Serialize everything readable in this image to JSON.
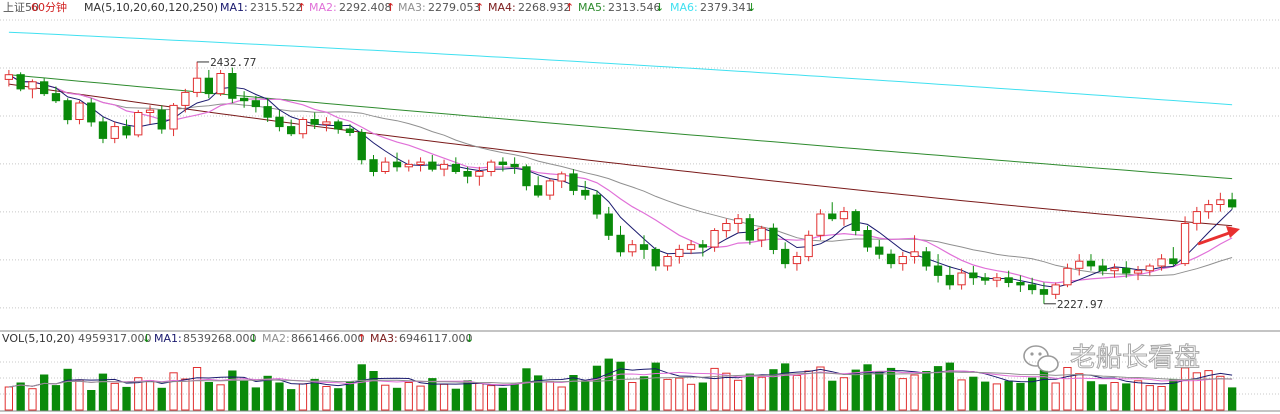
{
  "header": {
    "symbol": "上证50",
    "period": "60分钟",
    "ma_label": "MA(5,10,20,60,120,250)",
    "ma1_label": "MA1:",
    "ma1_value": "2315.522",
    "ma1_arrow": "↑",
    "ma2_label": "MA2:",
    "ma2_value": "2292.408",
    "ma2_arrow": "↑",
    "ma3_label": "MA3:",
    "ma3_value": "2279.053",
    "ma3_arrow": "↑",
    "ma4_label": "MA4:",
    "ma4_value": "2268.932",
    "ma4_arrow": "↑",
    "ma5_label": "MA5:",
    "ma5_value": "2313.546",
    "ma5_arrow": "↓",
    "ma6_label": "MA6:",
    "ma6_value": "2379.341",
    "ma6_arrow": "↓"
  },
  "volume_header": {
    "vol_label": "VOL(5,10,20)",
    "vol_value": "4959317.000",
    "vol_arrow": "↓",
    "ma1_label": "MA1:",
    "ma1_value": "8539268.000",
    "ma1_arrow": "↓",
    "ma2_label": "MA2:",
    "ma2_value": "8661466.000",
    "ma2_arrow": "↑",
    "ma3_label": "MA3:",
    "ma3_value": "6946117.000",
    "ma3_arrow": "↓"
  },
  "annotations": {
    "high_label": "2432.77",
    "low_label": "2227.97"
  },
  "watermark": {
    "text": "老船长看盘"
  },
  "colors": {
    "up": "#e03030",
    "down": "#0a8a0a",
    "ma1": "#1a1a6e",
    "ma2": "#e070d8",
    "ma3": "#909090",
    "ma4": "#7a1a1a",
    "ma5": "#2e8b2e",
    "ma6": "#40e0f0",
    "arrow": "#e83030",
    "label_gray": "#555555",
    "label_red": "#d02020",
    "label_green": "#108a10"
  },
  "chart_data": [
    {
      "type": "candlestick",
      "title": "上证50 60分钟",
      "ylim": [
        2210,
        2470
      ],
      "ohlc": [
        [
          2418,
          2426,
          2412,
          2422
        ],
        [
          2422,
          2424,
          2408,
          2410
        ],
        [
          2410,
          2418,
          2402,
          2416
        ],
        [
          2416,
          2419,
          2404,
          2406
        ],
        [
          2406,
          2412,
          2398,
          2400
        ],
        [
          2400,
          2402,
          2380,
          2384
        ],
        [
          2384,
          2400,
          2380,
          2398
        ],
        [
          2398,
          2402,
          2378,
          2382
        ],
        [
          2382,
          2386,
          2364,
          2368
        ],
        [
          2368,
          2382,
          2364,
          2378
        ],
        [
          2378,
          2384,
          2368,
          2371
        ],
        [
          2371,
          2392,
          2369,
          2390
        ],
        [
          2390,
          2396,
          2380,
          2392
        ],
        [
          2392,
          2396,
          2372,
          2376
        ],
        [
          2376,
          2398,
          2370,
          2396
        ],
        [
          2396,
          2410,
          2390,
          2407
        ],
        [
          2407,
          2433,
          2403,
          2419
        ],
        [
          2419,
          2426,
          2402,
          2406
        ],
        [
          2406,
          2426,
          2404,
          2423
        ],
        [
          2423,
          2428,
          2398,
          2402
        ],
        [
          2402,
          2408,
          2394,
          2400
        ],
        [
          2400,
          2404,
          2390,
          2395
        ],
        [
          2395,
          2402,
          2382,
          2386
        ],
        [
          2386,
          2392,
          2374,
          2378
        ],
        [
          2378,
          2384,
          2370,
          2372
        ],
        [
          2372,
          2386,
          2368,
          2384
        ],
        [
          2384,
          2390,
          2376,
          2380
        ],
        [
          2380,
          2386,
          2374,
          2382
        ],
        [
          2382,
          2384,
          2372,
          2376
        ],
        [
          2376,
          2380,
          2370,
          2373
        ],
        [
          2373,
          2376,
          2346,
          2350
        ],
        [
          2350,
          2354,
          2336,
          2340
        ],
        [
          2340,
          2352,
          2338,
          2348
        ],
        [
          2348,
          2356,
          2340,
          2344
        ],
        [
          2344,
          2350,
          2340,
          2346
        ],
        [
          2346,
          2352,
          2340,
          2348
        ],
        [
          2348,
          2354,
          2340,
          2342
        ],
        [
          2342,
          2350,
          2336,
          2346
        ],
        [
          2346,
          2352,
          2338,
          2340
        ],
        [
          2340,
          2344,
          2330,
          2336
        ],
        [
          2336,
          2344,
          2328,
          2340
        ],
        [
          2340,
          2350,
          2336,
          2348
        ],
        [
          2348,
          2352,
          2340,
          2346
        ],
        [
          2346,
          2352,
          2338,
          2344
        ],
        [
          2344,
          2346,
          2324,
          2328
        ],
        [
          2328,
          2336,
          2318,
          2320
        ],
        [
          2320,
          2334,
          2316,
          2332
        ],
        [
          2332,
          2340,
          2326,
          2338
        ],
        [
          2338,
          2342,
          2320,
          2324
        ],
        [
          2324,
          2332,
          2316,
          2320
        ],
        [
          2320,
          2324,
          2300,
          2304
        ],
        [
          2304,
          2310,
          2282,
          2286
        ],
        [
          2286,
          2294,
          2268,
          2272
        ],
        [
          2272,
          2282,
          2268,
          2278
        ],
        [
          2278,
          2286,
          2266,
          2274
        ],
        [
          2274,
          2276,
          2256,
          2260
        ],
        [
          2260,
          2270,
          2256,
          2268
        ],
        [
          2268,
          2278,
          2262,
          2274
        ],
        [
          2274,
          2282,
          2270,
          2278
        ],
        [
          2278,
          2282,
          2268,
          2276
        ],
        [
          2276,
          2292,
          2272,
          2290
        ],
        [
          2290,
          2300,
          2284,
          2296
        ],
        [
          2296,
          2304,
          2288,
          2300
        ],
        [
          2300,
          2304,
          2278,
          2282
        ],
        [
          2282,
          2294,
          2276,
          2292
        ],
        [
          2292,
          2296,
          2270,
          2274
        ],
        [
          2274,
          2280,
          2258,
          2262
        ],
        [
          2262,
          2272,
          2256,
          2268
        ],
        [
          2268,
          2290,
          2264,
          2286
        ],
        [
          2286,
          2308,
          2282,
          2304
        ],
        [
          2304,
          2314,
          2298,
          2300
        ],
        [
          2300,
          2310,
          2294,
          2306
        ],
        [
          2306,
          2308,
          2286,
          2290
        ],
        [
          2290,
          2294,
          2272,
          2276
        ],
        [
          2276,
          2282,
          2266,
          2270
        ],
        [
          2270,
          2274,
          2258,
          2262
        ],
        [
          2262,
          2272,
          2256,
          2268
        ],
        [
          2268,
          2286,
          2262,
          2272
        ],
        [
          2272,
          2276,
          2256,
          2260
        ],
        [
          2260,
          2270,
          2246,
          2252
        ],
        [
          2252,
          2260,
          2240,
          2244
        ],
        [
          2244,
          2258,
          2240,
          2254
        ],
        [
          2254,
          2260,
          2244,
          2250
        ],
        [
          2250,
          2254,
          2244,
          2248
        ],
        [
          2248,
          2254,
          2242,
          2250
        ],
        [
          2250,
          2256,
          2242,
          2246
        ],
        [
          2246,
          2252,
          2238,
          2244
        ],
        [
          2244,
          2250,
          2236,
          2240
        ],
        [
          2240,
          2246,
          2228,
          2236
        ],
        [
          2236,
          2246,
          2232,
          2244
        ],
        [
          2244,
          2262,
          2242,
          2258
        ],
        [
          2258,
          2270,
          2252,
          2264
        ],
        [
          2264,
          2270,
          2256,
          2260
        ],
        [
          2260,
          2266,
          2252,
          2256
        ],
        [
          2256,
          2262,
          2250,
          2258
        ],
        [
          2258,
          2264,
          2250,
          2254
        ],
        [
          2254,
          2260,
          2248,
          2256
        ],
        [
          2256,
          2262,
          2252,
          2260
        ],
        [
          2260,
          2270,
          2256,
          2266
        ],
        [
          2266,
          2276,
          2260,
          2262
        ],
        [
          2262,
          2302,
          2260,
          2296
        ],
        [
          2296,
          2310,
          2290,
          2306
        ],
        [
          2306,
          2316,
          2300,
          2312
        ],
        [
          2312,
          2322,
          2306,
          2316
        ],
        [
          2316,
          2322,
          2308,
          2310
        ]
      ],
      "high_mark": 2432.77,
      "low_mark": 2227.97
    },
    {
      "type": "bar",
      "title": "VOL(5,10,20)",
      "ylim": [
        0,
        14000000
      ],
      "values": [
        5.2,
        6.1,
        4.8,
        7.9,
        5.5,
        9.2,
        6.8,
        4.4,
        8.1,
        6.0,
        5.1,
        7.3,
        6.6,
        4.9,
        8.4,
        7.0,
        9.6,
        6.2,
        5.7,
        8.8,
        6.5,
        5.0,
        7.6,
        6.1,
        4.6,
        5.9,
        6.9,
        5.3,
        4.8,
        6.4,
        10.2,
        8.7,
        5.6,
        4.9,
        6.2,
        5.4,
        7.1,
        5.8,
        4.7,
        6.6,
        6.0,
        5.5,
        4.9,
        5.8,
        9.3,
        7.7,
        6.4,
        5.2,
        7.8,
        6.6,
        9.9,
        11.5,
        10.8,
        6.2,
        7.5,
        10.6,
        6.9,
        7.2,
        5.8,
        6.1,
        9.4,
        8.3,
        6.7,
        8.1,
        7.4,
        9.1,
        10.4,
        7.8,
        8.8,
        9.7,
        6.5,
        7.3,
        9.0,
        10.2,
        8.6,
        9.4,
        7.1,
        7.9,
        8.7,
        9.8,
        10.6,
        6.8,
        7.4,
        6.3,
        5.9,
        6.5,
        6.0,
        7.2,
        8.9,
        6.1,
        9.6,
        8.2,
        6.4,
        5.7,
        6.2,
        5.9,
        6.6,
        5.5,
        5.3,
        6.9,
        9.5,
        8.4,
        8.9,
        7.6,
        5.0
      ],
      "values_unit": "million",
      "up_flags_from_candles": true
    }
  ]
}
